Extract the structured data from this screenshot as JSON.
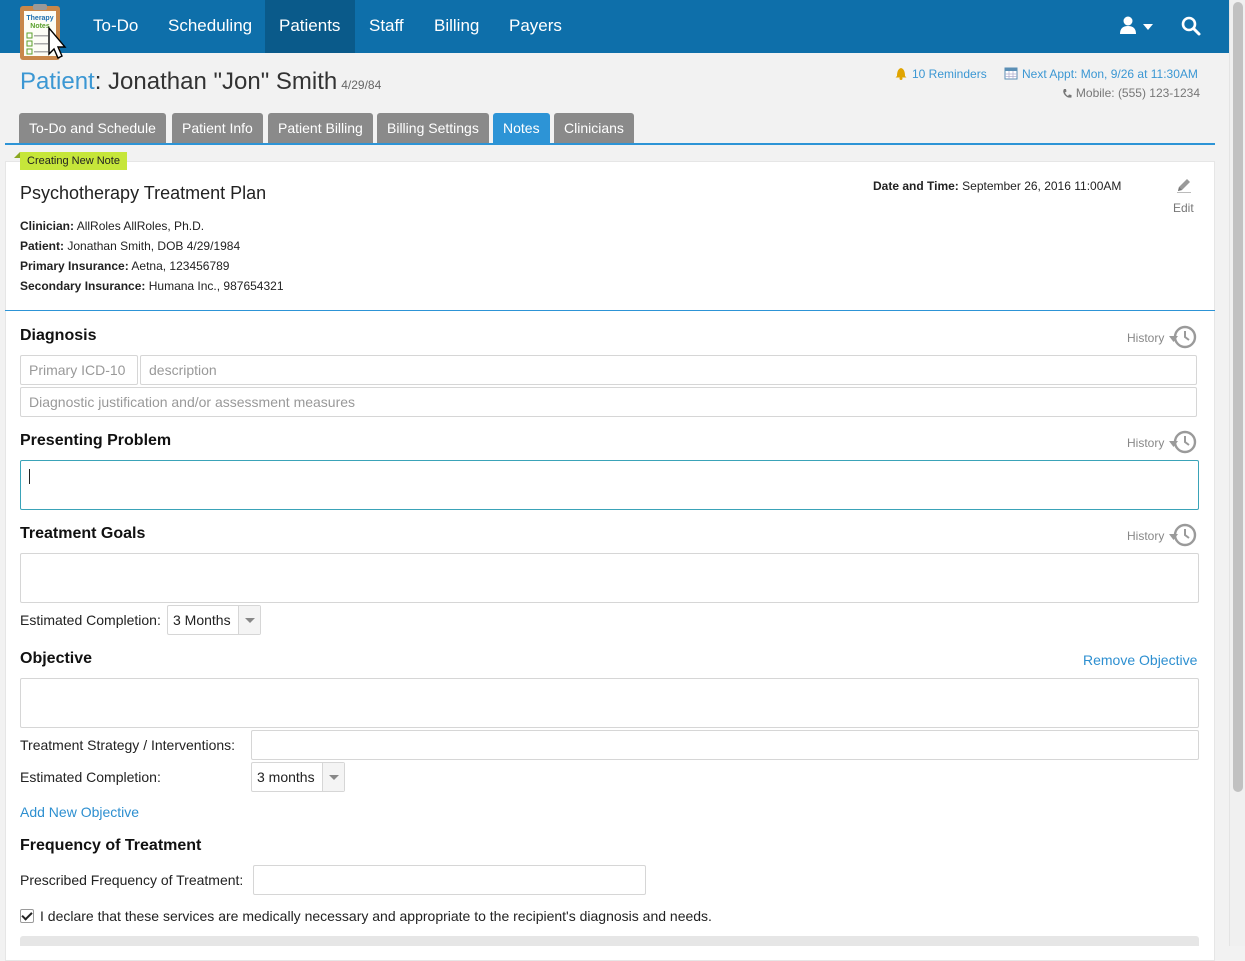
{
  "logo": {
    "line1": "Therapy",
    "line2": "Notes"
  },
  "nav": {
    "items": [
      "To-Do",
      "Scheduling",
      "Patients",
      "Staff",
      "Billing",
      "Payers"
    ],
    "active": "Patients"
  },
  "patient": {
    "label": "Patient",
    "name": ": Jonathan \"Jon\" Smith",
    "dob_short": "4/29/84"
  },
  "header_right": {
    "reminders": "10 Reminders",
    "next_appt": "Next Appt: Mon, 9/26 at 11:30AM",
    "mobile": "Mobile: (555) 123-1234"
  },
  "tabs": [
    "To-Do and Schedule",
    "Patient Info",
    "Patient Billing",
    "Billing Settings",
    "Notes",
    "Clinicians"
  ],
  "active_tab": "Notes",
  "note": {
    "badge": "Creating New Note",
    "title": "Psychotherapy Treatment Plan",
    "datetime_label": "Date and Time:",
    "datetime_value": "September 26, 2016 11:00AM",
    "edit_label": "Edit",
    "clinician_label": "Clinician:",
    "clinician_value": "AllRoles AllRoles, Ph.D.",
    "patient_label": "Patient:",
    "patient_value": "Jonathan Smith, DOB 4/29/1984",
    "primary_ins_label": "Primary Insurance:",
    "primary_ins_value": "Aetna, 123456789",
    "secondary_ins_label": "Secondary Insurance:",
    "secondary_ins_value": "Humana Inc., 987654321"
  },
  "form": {
    "history_label": "History",
    "diagnosis_title": "Diagnosis",
    "icd_placeholder": "Primary ICD-10",
    "description_placeholder": "description",
    "justification_placeholder": "Diagnostic justification and/or assessment measures",
    "presenting_title": "Presenting Problem",
    "goals_title": "Treatment Goals",
    "est_completion_label": "Estimated Completion:",
    "goals_completion_value": "3 Months",
    "objective_title": "Objective",
    "remove_objective": "Remove Objective",
    "strategy_label": "Treatment Strategy / Interventions:",
    "objective_completion_value": "3 months",
    "add_objective": "Add New Objective",
    "frequency_title": "Frequency of Treatment",
    "prescribed_label": "Prescribed Frequency of Treatment:",
    "declaration": "I declare that these services are medically necessary and appropriate to the recipient's diagnosis and needs.",
    "declaration_checked": true
  },
  "colors": {
    "nav_bg": "#0e6faa",
    "accent": "#2d94d6",
    "badge": "#c6e63a",
    "tab_inactive": "#8a8a8a"
  }
}
